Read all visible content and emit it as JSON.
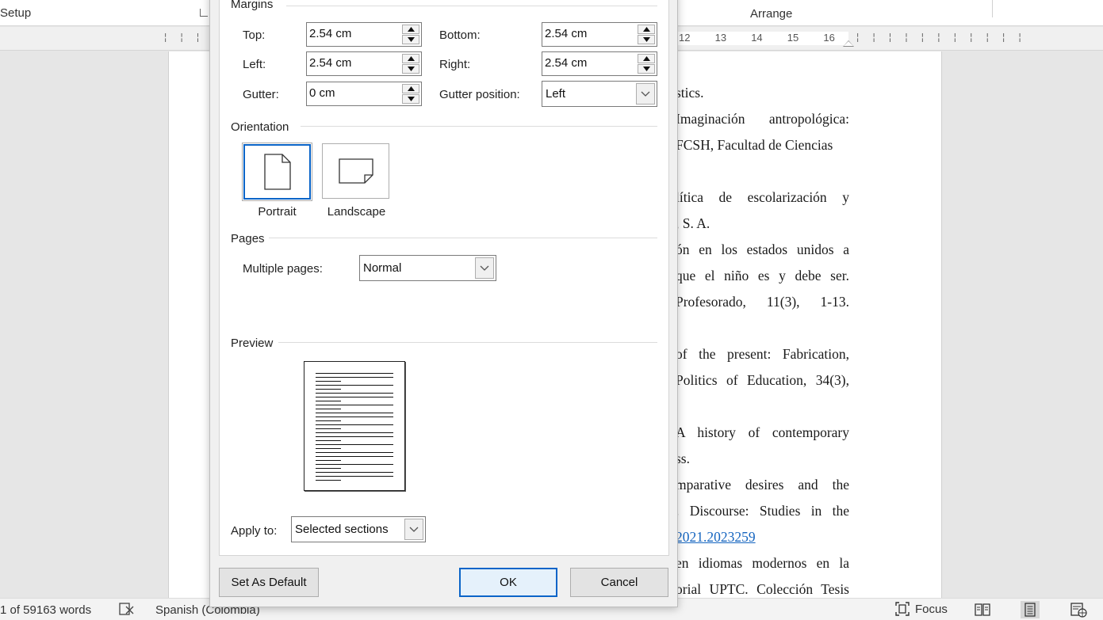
{
  "ribbon": {
    "group_setup": "Setup",
    "group_arrange": "Arrange"
  },
  "ruler": {
    "numbers": [
      "12",
      "13",
      "14",
      "15",
      "16"
    ]
  },
  "document": {
    "lines": [
      "stics.",
      "Imaginación antropológica:",
      "FCSH, Facultad de Ciencias",
      "",
      "lítica de escolarización y",
      ", S. A.",
      "ón en los estados unidos a",
      "que el niño es y debe ser.",
      "Profesorado, 11(3), 1-13.",
      "",
      "of the present: Fabrication,",
      "Politics of Education, 34(3),",
      "",
      "A history of contemporary",
      "ss.",
      "mparative desires and the",
      ". Discourse: Studies in the",
      "2021.2023259",
      "en idiomas modernos en la",
      "orial UPTC. Colección Tesis"
    ]
  },
  "statusbar": {
    "word_count": "1 of 59163 words",
    "language": "Spanish (Colombia)",
    "focus_label": "Focus"
  },
  "dialog": {
    "margins": {
      "title": "Margins",
      "top_label": "Top:",
      "top_value": "2.54 cm",
      "bottom_label": "Bottom:",
      "bottom_value": "2.54 cm",
      "left_label": "Left:",
      "left_value": "2.54 cm",
      "right_label": "Right:",
      "right_value": "2.54 cm",
      "gutter_label": "Gutter:",
      "gutter_value": "0 cm",
      "gutter_position_label": "Gutter position:",
      "gutter_position_value": "Left"
    },
    "orientation": {
      "title": "Orientation",
      "portrait_label": "Portrait",
      "landscape_label": "Landscape",
      "selected": "portrait"
    },
    "pages": {
      "title": "Pages",
      "multiple_pages_label": "Multiple pages:",
      "multiple_pages_value": "Normal"
    },
    "preview": {
      "title": "Preview"
    },
    "apply_to": {
      "label": "Apply to:",
      "value": "Selected sections"
    },
    "buttons": {
      "set_default": "Set As Default",
      "ok": "OK",
      "cancel": "Cancel"
    },
    "accent_color": "#0a64c8"
  }
}
